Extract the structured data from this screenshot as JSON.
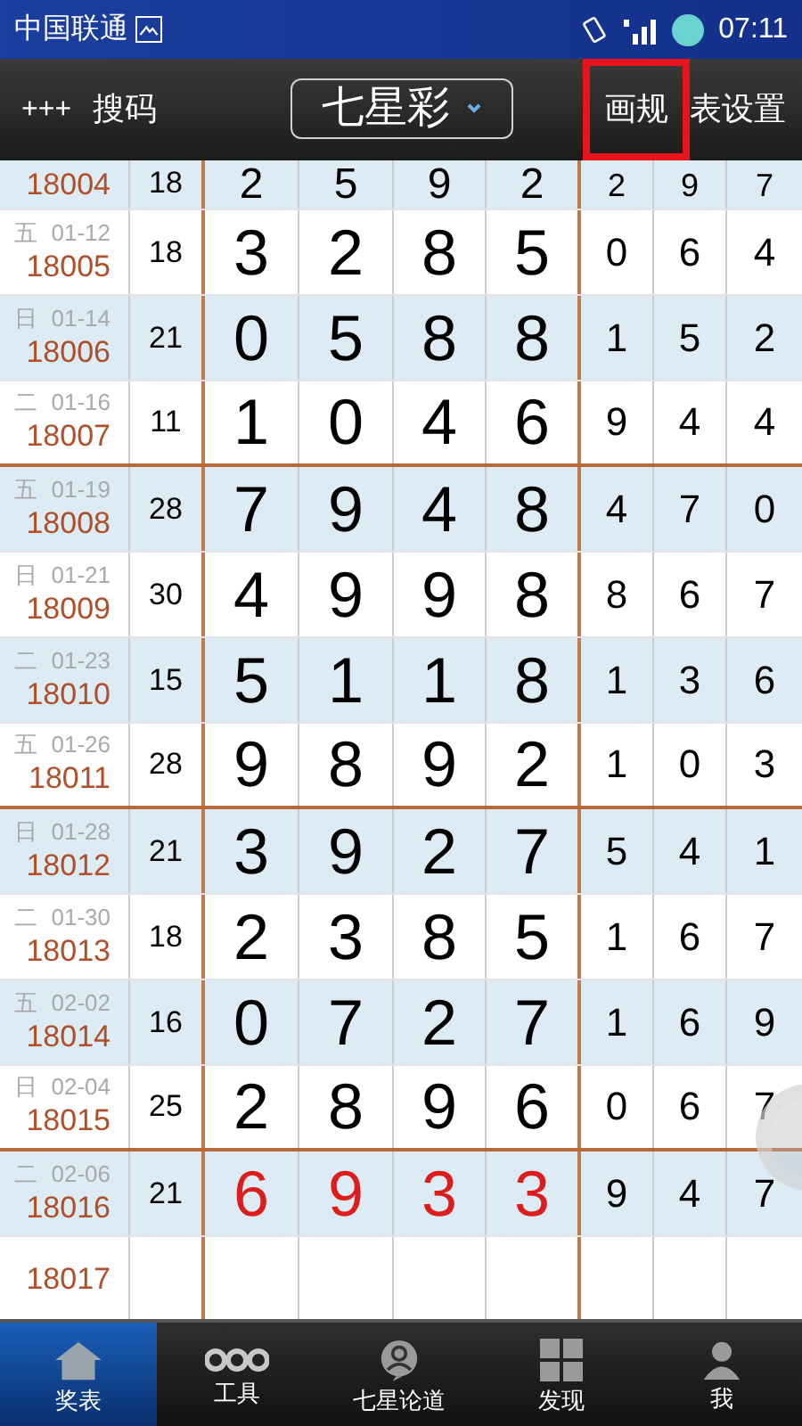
{
  "status_bar": {
    "carrier": "中国联通",
    "time": "07:11"
  },
  "header": {
    "left_icon": "+++",
    "left_label": "搜码",
    "title": "七星彩",
    "right_highlighted": "画规",
    "right_rest": "表设置"
  },
  "rows": [
    {
      "issue": "18004",
      "sum": "18",
      "main": [
        "2",
        "5",
        "9",
        "2"
      ],
      "extra": [
        "2",
        "9",
        "7"
      ],
      "highlight": false,
      "divider_below": false
    },
    {
      "weekday": "五",
      "date": "01-12",
      "issue": "18005",
      "sum": "18",
      "main": [
        "3",
        "2",
        "8",
        "5"
      ],
      "extra": [
        "0",
        "6",
        "4"
      ],
      "highlight": false,
      "divider_below": false
    },
    {
      "weekday": "日",
      "date": "01-14",
      "issue": "18006",
      "sum": "21",
      "main": [
        "0",
        "5",
        "8",
        "8"
      ],
      "extra": [
        "1",
        "5",
        "2"
      ],
      "highlight": false,
      "divider_below": false
    },
    {
      "weekday": "二",
      "date": "01-16",
      "issue": "18007",
      "sum": "11",
      "main": [
        "1",
        "0",
        "4",
        "6"
      ],
      "extra": [
        "9",
        "4",
        "4"
      ],
      "highlight": false,
      "divider_below": true
    },
    {
      "weekday": "五",
      "date": "01-19",
      "issue": "18008",
      "sum": "28",
      "main": [
        "7",
        "9",
        "4",
        "8"
      ],
      "extra": [
        "4",
        "7",
        "0"
      ],
      "highlight": false,
      "divider_below": false
    },
    {
      "weekday": "日",
      "date": "01-21",
      "issue": "18009",
      "sum": "30",
      "main": [
        "4",
        "9",
        "9",
        "8"
      ],
      "extra": [
        "8",
        "6",
        "7"
      ],
      "highlight": false,
      "divider_below": false
    },
    {
      "weekday": "二",
      "date": "01-23",
      "issue": "18010",
      "sum": "15",
      "main": [
        "5",
        "1",
        "1",
        "8"
      ],
      "extra": [
        "1",
        "3",
        "6"
      ],
      "highlight": false,
      "divider_below": false
    },
    {
      "weekday": "五",
      "date": "01-26",
      "issue": "18011",
      "sum": "28",
      "main": [
        "9",
        "8",
        "9",
        "2"
      ],
      "extra": [
        "1",
        "0",
        "3"
      ],
      "highlight": false,
      "divider_below": true
    },
    {
      "weekday": "日",
      "date": "01-28",
      "issue": "18012",
      "sum": "21",
      "main": [
        "3",
        "9",
        "2",
        "7"
      ],
      "extra": [
        "5",
        "4",
        "1"
      ],
      "highlight": false,
      "divider_below": false
    },
    {
      "weekday": "二",
      "date": "01-30",
      "issue": "18013",
      "sum": "18",
      "main": [
        "2",
        "3",
        "8",
        "5"
      ],
      "extra": [
        "1",
        "6",
        "7"
      ],
      "highlight": false,
      "divider_below": false
    },
    {
      "weekday": "五",
      "date": "02-02",
      "issue": "18014",
      "sum": "16",
      "main": [
        "0",
        "7",
        "2",
        "7"
      ],
      "extra": [
        "1",
        "6",
        "9"
      ],
      "highlight": false,
      "divider_below": false
    },
    {
      "weekday": "日",
      "date": "02-04",
      "issue": "18015",
      "sum": "25",
      "main": [
        "2",
        "8",
        "9",
        "6"
      ],
      "extra": [
        "0",
        "6",
        "7"
      ],
      "highlight": false,
      "divider_below": true
    },
    {
      "weekday": "二",
      "date": "02-06",
      "issue": "18016",
      "sum": "21",
      "main": [
        "6",
        "9",
        "3",
        "3"
      ],
      "extra": [
        "9",
        "4",
        "7"
      ],
      "highlight": true,
      "divider_below": false
    },
    {
      "issue": "18017",
      "divider_below": false
    }
  ],
  "tabs": [
    {
      "label": "奖表",
      "kind": "home",
      "selected": true
    },
    {
      "label": "工具",
      "kind": "dots",
      "selected": false
    },
    {
      "label": "七星论道",
      "kind": "person",
      "selected": false
    },
    {
      "label": "发现",
      "kind": "grid",
      "selected": false
    },
    {
      "label": "我",
      "kind": "user",
      "selected": false
    }
  ]
}
